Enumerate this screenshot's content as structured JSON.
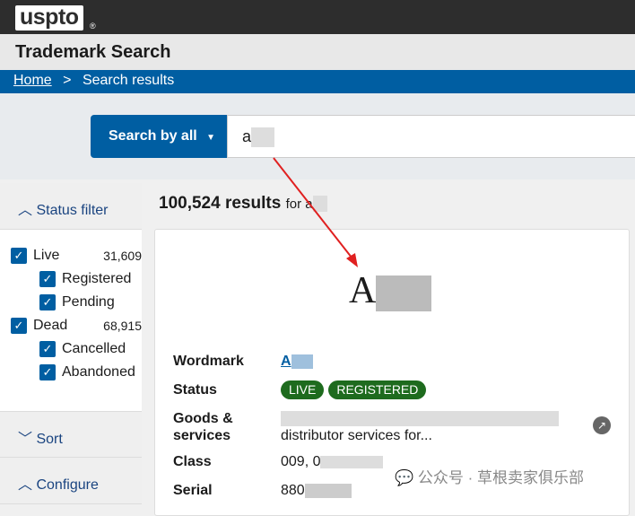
{
  "header": {
    "logo": "uspto",
    "registered": "®",
    "app_title": "Trademark Search"
  },
  "breadcrumb": {
    "home": "Home",
    "separator": ">",
    "current": "Search results"
  },
  "search": {
    "mode_label": "Search by all",
    "query": "a"
  },
  "sidebar": {
    "status_filter": "Status filter",
    "items": [
      {
        "label": "Live",
        "count": "31,609",
        "checked": true,
        "level": 0
      },
      {
        "label": "Registered",
        "checked": true,
        "level": 1
      },
      {
        "label": "Pending",
        "checked": true,
        "level": 1
      },
      {
        "label": "Dead",
        "count": "68,915",
        "checked": true,
        "level": 0
      },
      {
        "label": "Cancelled",
        "checked": true,
        "level": 1
      },
      {
        "label": "Abandoned",
        "checked": true,
        "level": 1
      }
    ],
    "sort": "Sort",
    "configure": "Configure"
  },
  "results": {
    "count": "100,524",
    "count_suffix": "results",
    "for_label": "for a"
  },
  "card": {
    "mark_image_text": "A",
    "wordmark_label": "Wordmark",
    "wordmark": "A",
    "status_label": "Status",
    "status_badges": [
      "LIVE",
      "REGISTERED"
    ],
    "goods_label": "Goods &",
    "goods_label2": "services",
    "goods": "distributor services for...",
    "class_label": "Class",
    "class": "009, 0",
    "serial_label": "Serial",
    "serial": "880"
  },
  "watermark": "公众号 · 草根卖家俱乐部",
  "colors": {
    "brand_blue": "#005ea2",
    "badge_green": "#1e6b1e",
    "top_bar": "#2d2d2d",
    "annotation_arrow": "#e02020"
  }
}
